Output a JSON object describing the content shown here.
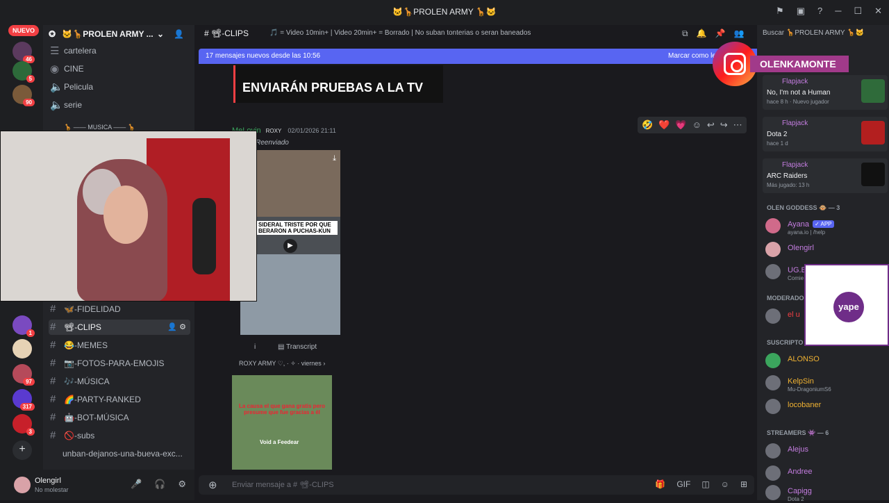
{
  "window": {
    "title": "🐱🦒PROLEN ARMY 🦒🐱",
    "nuevo": "NUEVO"
  },
  "servers": [
    {
      "badge": "46"
    },
    {
      "badge": "5"
    },
    {
      "badge": "90"
    },
    {
      "badge": "1"
    },
    {
      "badge": "97"
    },
    {
      "badge": "317"
    },
    {
      "badge": "3"
    }
  ],
  "sidebar": {
    "server_name": "🐱🦒PROLEN ARMY ...",
    "channels_top": [
      "cartelera",
      "CINE",
      "Pelicula",
      "serie"
    ],
    "category_music": "🦒 —— MUSICA —— 🦒",
    "channels": [
      {
        "label": "🦋-FIDELIDAD"
      },
      {
        "label": "📽-CLIPS",
        "active": true
      },
      {
        "label": "😂-MEMES"
      },
      {
        "label": "📷-FOTOS-PARA-EMOJIS"
      },
      {
        "label": "🎶-MÚSICA"
      },
      {
        "label": "🌈-PARTY-RANKED"
      },
      {
        "label": "🤖-BOT-MÚSICA"
      },
      {
        "label": "🚫-subs"
      },
      {
        "label": "unban-dejanos-una-bueva-exc..."
      }
    ]
  },
  "user": {
    "name": "Olengirl",
    "status": "No molestar"
  },
  "chat": {
    "channel": "📽-CLIPS",
    "topic": "🎵 = Video 10min+ | Video 20min+ = Borrado | No suban tonterias o seran baneados",
    "new_messages": "17 mensajes nuevos desde las 10:56",
    "mark_read": "Marcar como leído",
    "thumb1_headline": "ENVIARÁN PRUEBAS A LA TV",
    "message": {
      "author": "MeLovin",
      "tag": "ROXY",
      "timestamp": "02/01/2026 21:11",
      "forwarded": "Reenviado",
      "video_caption": "SIDERAL TRISTE POR QUE BERARON A PUCHAS-KUN",
      "transcript": "Transcript",
      "footer": "ROXY ARMY ♡, · ✧ · viernes",
      "video2_caption": "La causa el que gana gratis pero presume que fue gracias a él",
      "video2_label": "Void a Feedear"
    },
    "reactions": [
      "🤣",
      "❤️",
      "💗"
    ],
    "composer_placeholder": "Enviar mensaje a # 📽-CLIPS"
  },
  "members": {
    "search": "Buscar 🦒PROLEN ARMY 🦒🐱",
    "activities": [
      {
        "who": "Flapjack",
        "what": "No, I'm not a Human",
        "when": "hace 8 h · Nuevo jugador",
        "color": "#2f6b3a"
      },
      {
        "who": "Flapjack",
        "what": "Dota 2",
        "when": "hace 1 d",
        "color": "#b31f1f"
      },
      {
        "who": "Flapjack",
        "what": "ARC Raiders",
        "when": "Más jugado: 13 h",
        "color": "#111111"
      }
    ],
    "groups": [
      {
        "title": "OLEN GODDESS 🐵 — 3",
        "items": [
          {
            "name": "Ayana",
            "sub": "ayana.io | /help",
            "badge": "✓ APP"
          },
          {
            "name": "Olengirl",
            "sub": ""
          },
          {
            "name": "UG.B",
            "sub": "Comie"
          }
        ]
      },
      {
        "title": "MODERADO",
        "items": [
          {
            "name": "el u",
            "sub": ""
          }
        ]
      },
      {
        "title": "SUSCRIPTO",
        "items": [
          {
            "name": "ALONSO",
            "sub": ""
          },
          {
            "name": "KelpSin",
            "sub": "Mu-DragoniumS6"
          },
          {
            "name": "locobaner",
            "sub": ""
          }
        ]
      },
      {
        "title": "STREAMERS 👾 — 6",
        "items": [
          {
            "name": "Alejus",
            "sub": ""
          },
          {
            "name": "Andree",
            "sub": ""
          },
          {
            "name": "Capigg",
            "sub": "Dota 2"
          }
        ]
      }
    ]
  },
  "overlay": {
    "instagram_handle": "OLENKAMONTE",
    "qr_brand": "yape"
  }
}
